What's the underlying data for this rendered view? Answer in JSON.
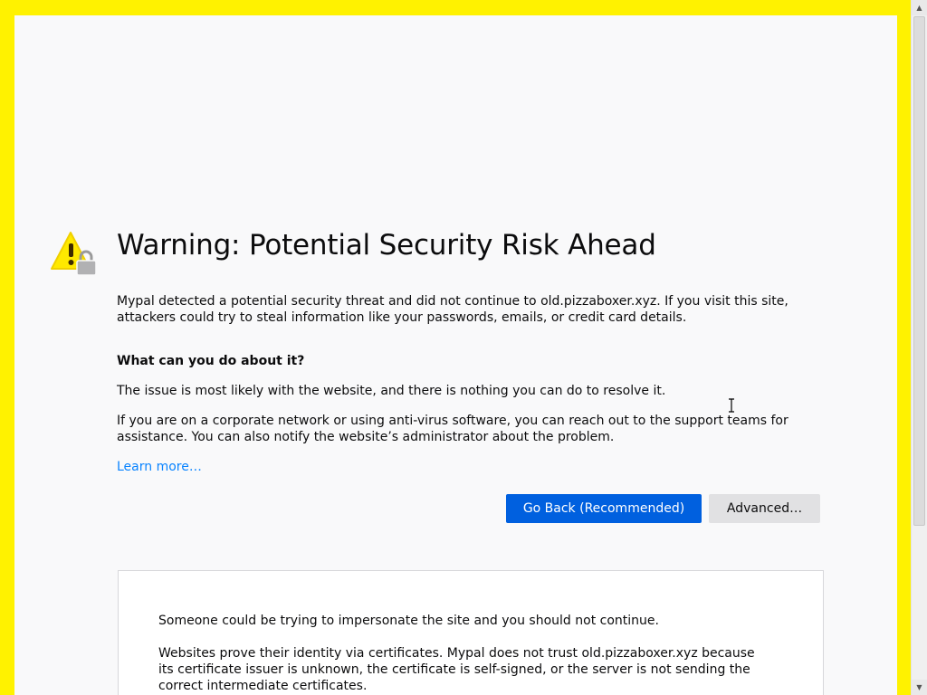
{
  "error_page": {
    "title": "Warning: Potential Security Risk Ahead",
    "intro": "Mypal detected a potential security threat and did not continue to old.pizzaboxer.xyz. If you visit this site, attackers could try to steal information like your passwords, emails, or credit card details.",
    "what_heading": "What can you do about it?",
    "issue_text": "The issue is most likely with the website, and there is nothing you can do to resolve it.",
    "corporate_text": "If you are on a corporate network or using anti-virus software, you can reach out to the support teams for assistance. You can also notify the website’s administrator about the problem.",
    "learn_more": "Learn more…",
    "go_back_label": "Go Back (Recommended)",
    "advanced_label": "Advanced…",
    "warning_icon": "warning-lock-icon"
  },
  "details": {
    "line1": "Someone could be trying to impersonate the site and you should not continue.",
    "line2": "Websites prove their identity via certificates. Mypal does not trust old.pizzaboxer.xyz because its certificate issuer is unknown, the certificate is self-signed, or the server is not sending the correct intermediate certificates."
  },
  "colors": {
    "frame": "#fff200",
    "page_background": "#f9f9fa",
    "primary_button": "#0060df",
    "secondary_button": "#e1e1e3",
    "link": "#0a84ff",
    "warning_yellow": "#ffe900"
  }
}
